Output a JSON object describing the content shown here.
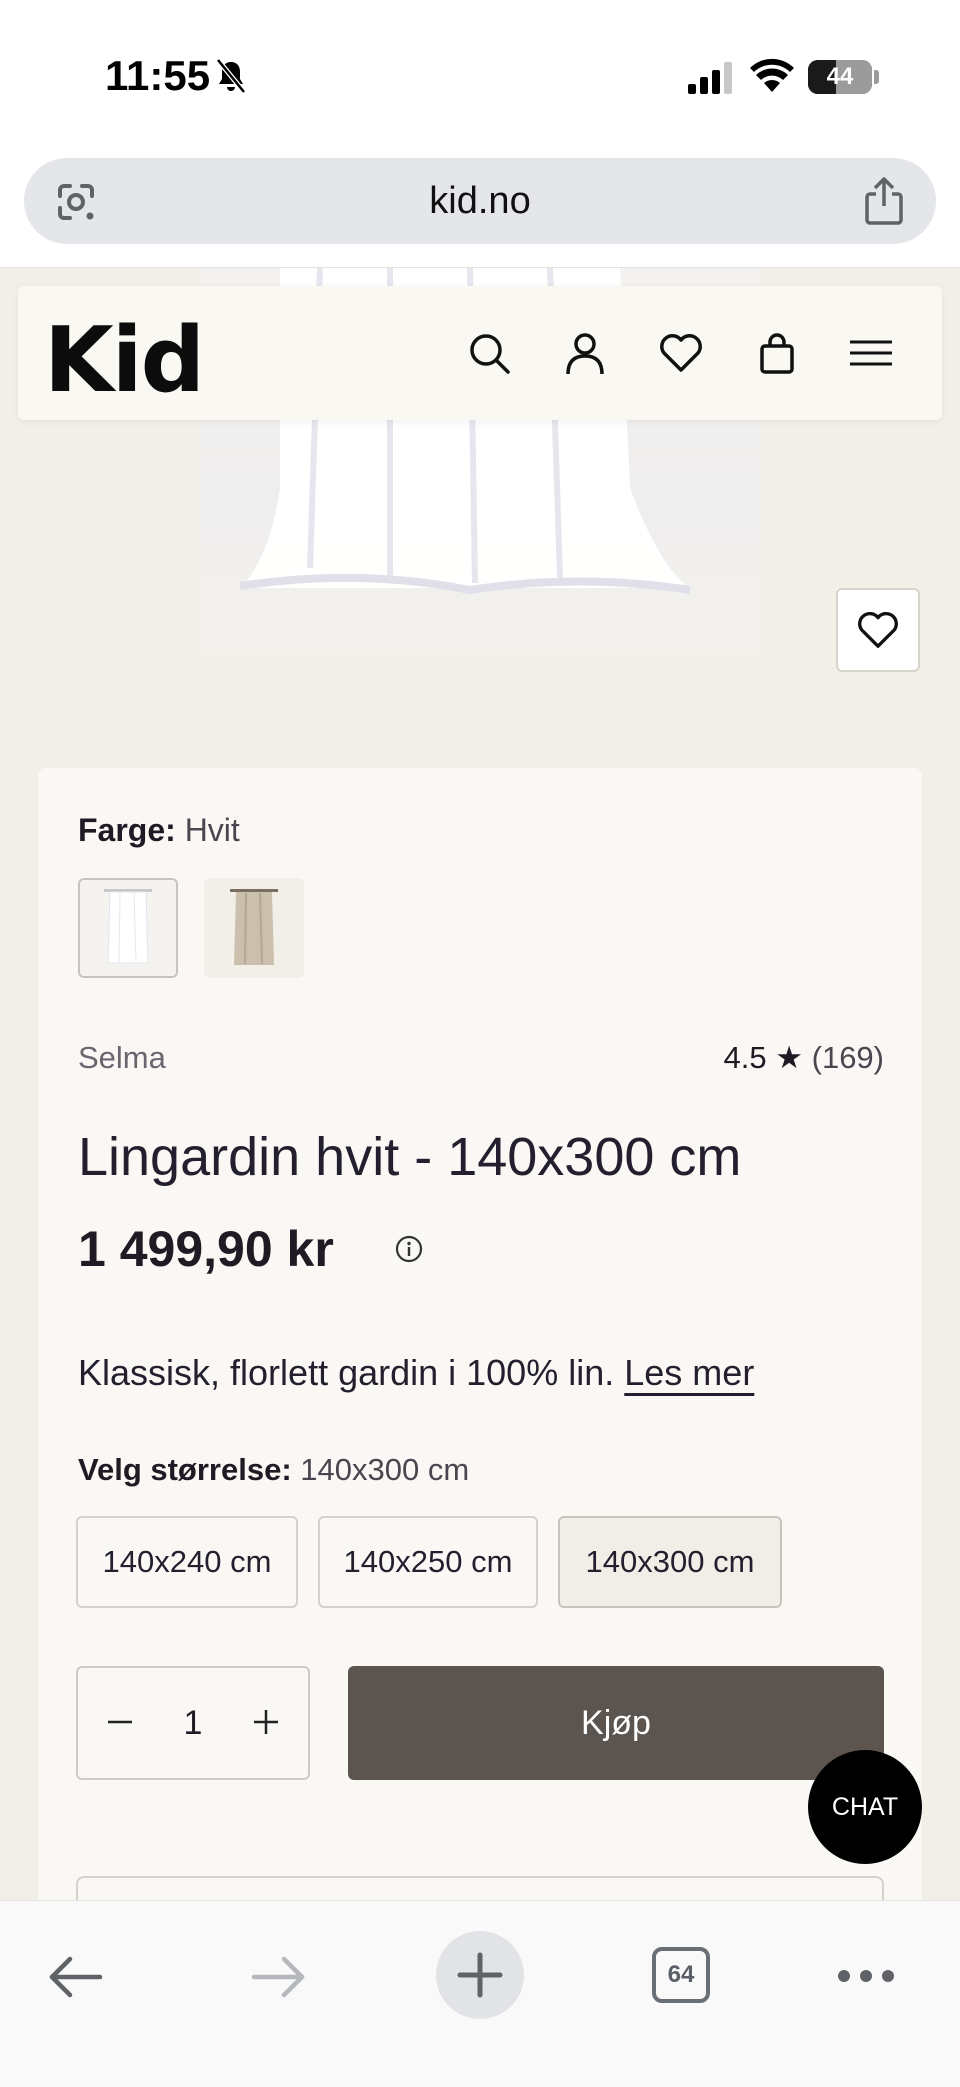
{
  "status_bar": {
    "time": "11:55",
    "battery": "44",
    "battery_level_percent": 44
  },
  "browser": {
    "url": "kid.no",
    "tab_count": "64"
  },
  "header": {
    "logo": "Kid",
    "icons": [
      "search-icon",
      "account-icon",
      "heart-icon",
      "bag-icon",
      "menu-icon"
    ]
  },
  "product": {
    "color_label": "Farge:",
    "color_value": "Hvit",
    "swatches": [
      "Hvit",
      "Beige"
    ],
    "brand": "Selma",
    "rating": "4.5 ★",
    "rating_count": "(169)",
    "title": "Lingardin hvit - 140x300 cm",
    "price": "1 499,90 kr",
    "description": "Klassisk, florlett gardin i 100% lin.",
    "read_more": "Les mer",
    "size_label": "Velg størrelse:",
    "size_value": "140x300 cm",
    "sizes": [
      "140x240 cm",
      "140x250 cm",
      "140x300 cm"
    ],
    "selected_size_index": 2,
    "quantity": "1",
    "buy_label": "Kjøp"
  },
  "chat": {
    "label": "CHAT"
  },
  "colors": {
    "page_bg": "#f2efe9",
    "card_bg": "#faf8f4",
    "buy_button": "#5c544e",
    "chat_button": "#000000"
  }
}
